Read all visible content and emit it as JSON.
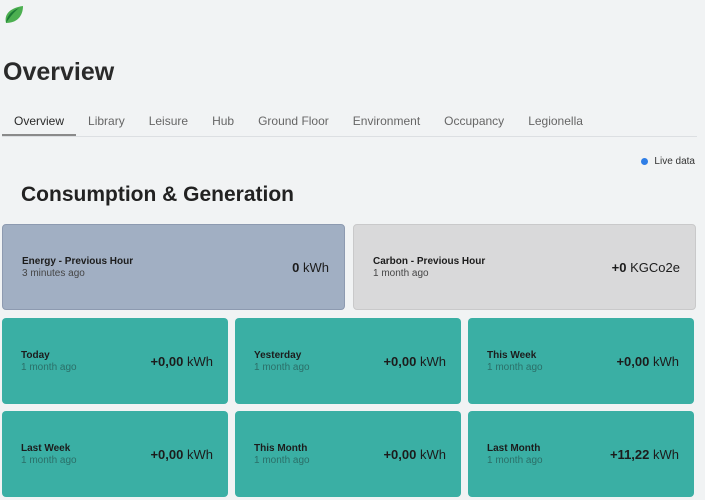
{
  "logo": {
    "icon": "leaf-logo-icon",
    "colors": {
      "leaf_light": "#4caf50",
      "leaf_dark": "#1b7a34"
    }
  },
  "page": {
    "title": "Overview"
  },
  "tabs": [
    {
      "label": "Overview",
      "active": true
    },
    {
      "label": "Library"
    },
    {
      "label": "Leisure"
    },
    {
      "label": "Hub"
    },
    {
      "label": "Ground Floor"
    },
    {
      "label": "Environment"
    },
    {
      "label": "Occupancy"
    },
    {
      "label": "Legionella"
    }
  ],
  "live": {
    "label": "Live data",
    "dot_color": "#2f7ee6"
  },
  "section": {
    "title": "Consumption & Generation"
  },
  "top_cards": {
    "energy": {
      "label": "Energy - Previous Hour",
      "sub": "3 minutes ago",
      "value": "0",
      "unit": "kWh",
      "color": "#a1afc3"
    },
    "carbon": {
      "label": "Carbon - Previous Hour",
      "sub": "1 month ago",
      "value": "+0",
      "unit": "KGCo2e",
      "color": "#d9d9da"
    }
  },
  "cards": [
    {
      "label": "Today",
      "sub": "1 month ago",
      "value": "+0,00",
      "unit": "kWh"
    },
    {
      "label": "Yesterday",
      "sub": "1 month ago",
      "value": "+0,00",
      "unit": "kWh"
    },
    {
      "label": "This Week",
      "sub": "1 month ago",
      "value": "+0,00",
      "unit": "kWh"
    },
    {
      "label": "Last Week",
      "sub": "1 month ago",
      "value": "+0,00",
      "unit": "kWh"
    },
    {
      "label": "This Month",
      "sub": "1 month ago",
      "value": "+0,00",
      "unit": "kWh"
    },
    {
      "label": "Last Month",
      "sub": "1 month ago",
      "value": "+11,22",
      "unit": "kWh"
    }
  ],
  "card_color": "#3aafa4"
}
